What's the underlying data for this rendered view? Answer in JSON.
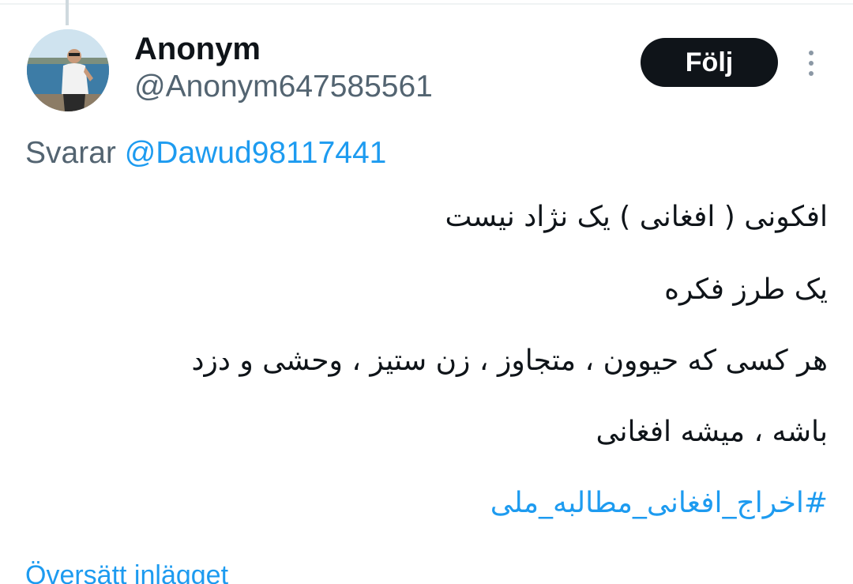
{
  "tweet": {
    "author": {
      "display_name": "Anonym",
      "handle": "@Anonym647585561",
      "avatar_icon": "user-photo-avatar"
    },
    "follow_button_label": "Följ",
    "more_icon": "vertical-ellipsis-icon",
    "reply": {
      "prefix": "Svarar",
      "mention": "@Dawud98117441"
    },
    "lines": [
      "افکونی ( افغانی ) یک نژاد نیست",
      "یک طرز فکره",
      "هر کسی که حیوون ، متجاوز ، زن ستیز ، وحشی و دزد",
      "باشه ، میشه افغانی"
    ],
    "hashtag": "#اخراج_افغانی_مطالبه_ملی",
    "translate_label": "Översätt inlägget"
  },
  "colors": {
    "text_primary": "#0f1419",
    "text_secondary": "#536471",
    "link": "#1d9bf0",
    "button_bg": "#0f1419",
    "button_text": "#ffffff"
  }
}
